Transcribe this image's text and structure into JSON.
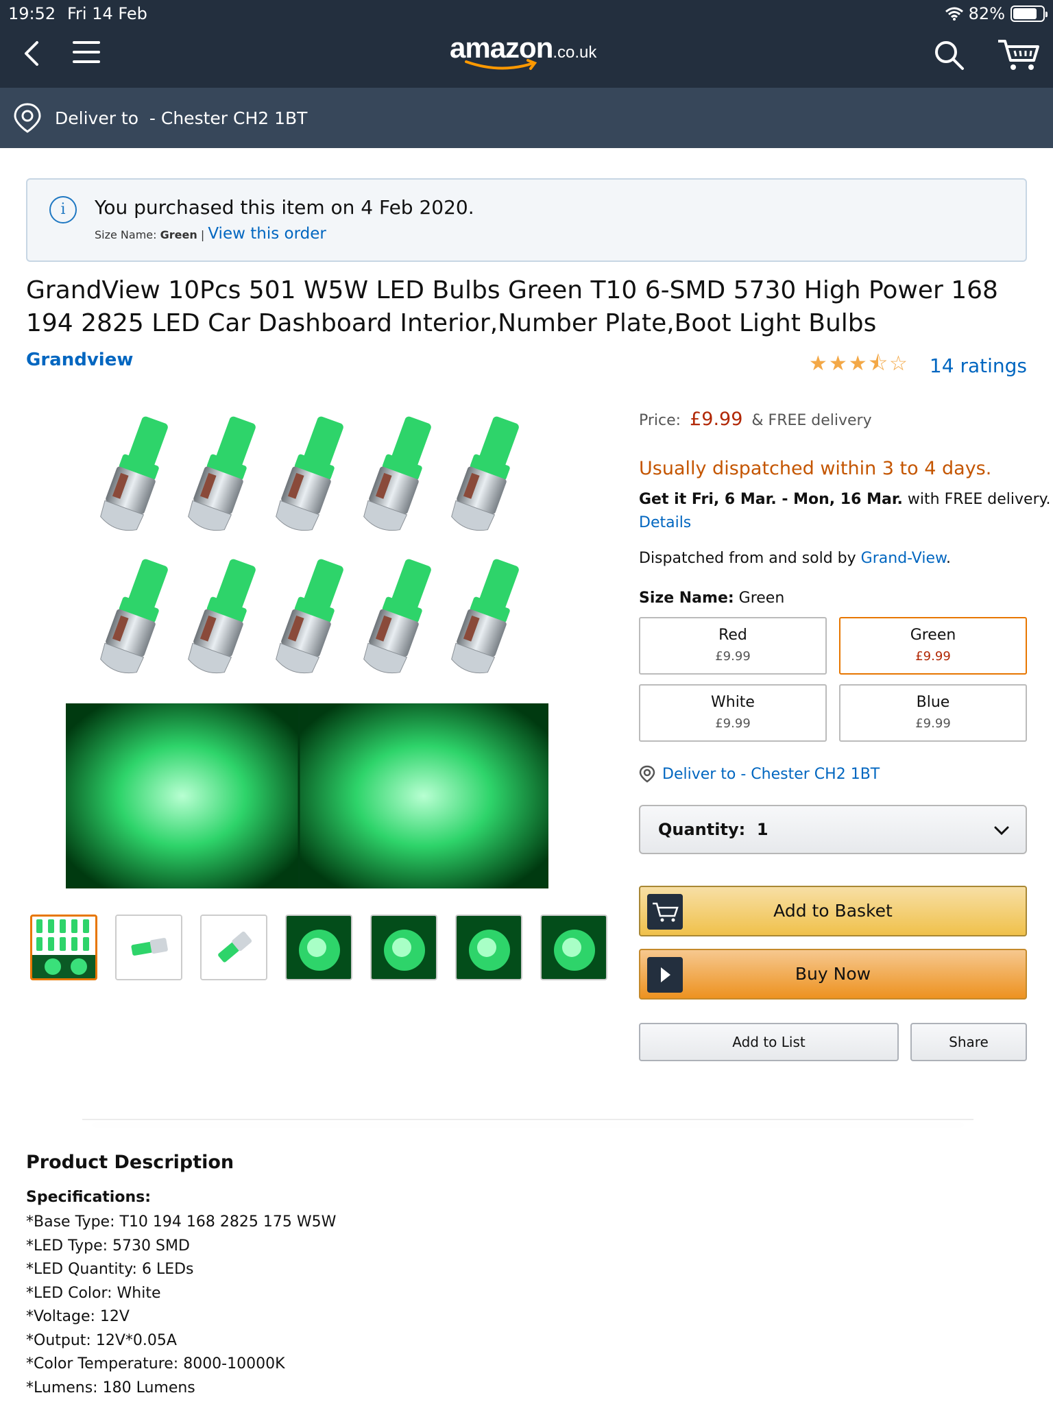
{
  "status": {
    "time": "19:52",
    "date": "Fri 14 Feb",
    "battery": "82%"
  },
  "header": {
    "logo_main": "amazon",
    "logo_tld": ".co.uk"
  },
  "deliver_bar": {
    "text": "Deliver to  - Chester CH2 1BT"
  },
  "notice": {
    "main": "You purchased this item on 4 Feb 2020.",
    "size_label": "Size Name:",
    "size_value": "Green",
    "separator": "|",
    "link": "View this order"
  },
  "product": {
    "title": "GrandView 10Pcs 501 W5W LED Bulbs Green T10 6-SMD 5730 High Power 168 194 2825 LED Car Dashboard Interior,Number Plate,Boot Light Bulbs",
    "brand": "Grandview",
    "stars": 3.5,
    "stars_glyphs": "★★★⯪☆",
    "ratings": "14 ratings"
  },
  "thumbnails_count": 7,
  "buybox": {
    "price_label": "Price:",
    "price": "£9.99",
    "delivery": "& FREE delivery",
    "dispatch": "Usually dispatched within 3 to 4 days.",
    "getit_prefix": "Get it Fri, 6 Mar. - Mon, 16 Mar.",
    "getit_suffix": " with FREE delivery.",
    "details": "Details",
    "sold_prefix": "Dispatched from and sold by ",
    "sold_by": "Grand-View",
    "sold_suffix": ".",
    "size_label": "Size Name:",
    "size_value": " Green",
    "swatches": [
      {
        "name": "Red",
        "price": "£9.99"
      },
      {
        "name": "Green",
        "price": "£9.99"
      },
      {
        "name": "White",
        "price": "£9.99"
      },
      {
        "name": "Blue",
        "price": "£9.99"
      }
    ],
    "deliver_to": "Deliver to - Chester CH2 1BT",
    "quantity": "Quantity:  1",
    "add_to_basket": "Add to Basket",
    "buy_now": "Buy Now",
    "add_to_list": "Add to List",
    "share": "Share"
  },
  "description": {
    "title": "Product Description",
    "spec_head": "Specifications:",
    "specs": [
      "*Base Type: T10 194 168 2825 175 W5W",
      "*LED Type: 5730 SMD",
      "*LED Quantity: 6 LEDs",
      "*LED Color: White",
      "*Voltage: 12V",
      "*Output: 12V*0.05A",
      "*Color Temperature: 8000-10000K",
      "*Lumens: 180 Lumens"
    ]
  },
  "colors": {
    "nav": "#232f3e",
    "deliver": "#37475a",
    "link": "#0066c0",
    "price": "#b12704",
    "led": "#2ed46a"
  }
}
